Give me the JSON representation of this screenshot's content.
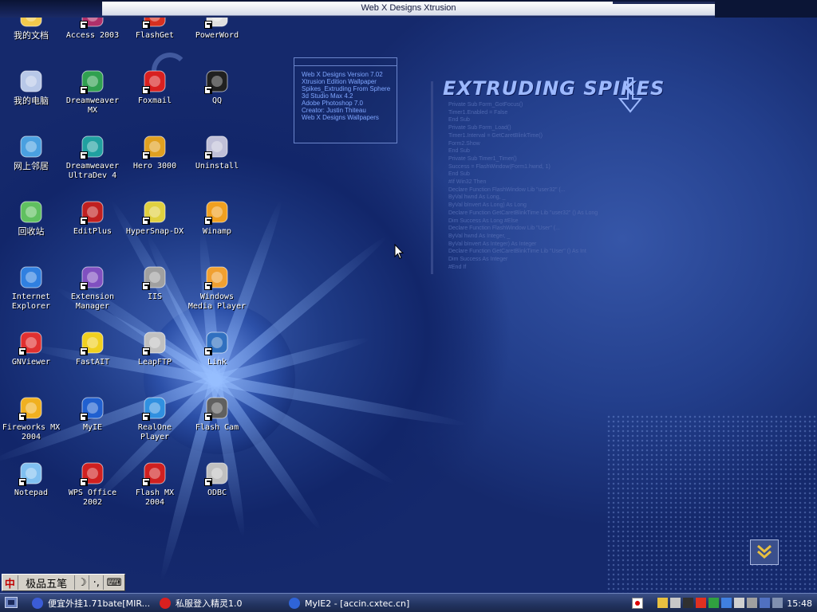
{
  "top_bar": {
    "title": "Web X Designs Xtrusion"
  },
  "info_box": {
    "lines": [
      "Web X Designs Version 7.02",
      "Xtrusion Edition Wallpaper",
      "Spikes_Extruding From Sphere",
      "3d Studio Max 4.2",
      "Adobe Photoshop 7.0",
      "Creator: Justin Thiteau",
      "Web X Designs Wallpapers"
    ]
  },
  "code_panel": {
    "title": "EXTRUDING SPIKES",
    "lines": [
      "Private Sub Form_GotFocus()",
      "   Timer1.Enabled = False",
      "   End Sub",
      "   Private Sub Form_Load()",
      "   Timer1.Interval = GetCaretBlinkTime()",
      "   Form2.Show",
      "   End Sub",
      "   Private Sub Timer1_Timer()",
      "   Success = FlashWindow(Form1.hwnd, 1)",
      " End Sub",
      "#If Win32 Then",
      "      Declare Function FlashWindow Lib \"user32\" (...",
      "      ByVal hwnd As Long, _",
      "      ByVal bInvert As Long) As Long",
      "      Declare Function GetCaretBlinkTime Lib \"user32\" () As Long",
      "      Dim Success As Long  #Else",
      "      Declare Function FlashWindow Lib \"User\" (...",
      "      ByVal hwnd As Integer, _",
      "      ByVal bInvert As Integer) As Integer",
      "      Declare Function GetCaretBlinkTime Lib \"User\" () As Int",
      "      Dim Success As Integer",
      "#End If"
    ]
  },
  "desktop_icons": [
    {
      "label": "我的文档",
      "icon": "folder-documents-icon"
    },
    {
      "label": "Access 2003",
      "icon": "access-icon"
    },
    {
      "label": "FlashGet",
      "icon": "flashget-icon"
    },
    {
      "label": "PowerWord",
      "icon": "powerword-icon"
    },
    {
      "label": "我的电脑",
      "icon": "computer-icon"
    },
    {
      "label": "Dreamweaver\nMX",
      "icon": "dreamweaver-icon"
    },
    {
      "label": "Foxmail",
      "icon": "foxmail-icon"
    },
    {
      "label": "QQ",
      "icon": "qq-penguin-icon"
    },
    {
      "label": "网上邻居",
      "icon": "network-icon"
    },
    {
      "label": "Dreamweaver\nUltraDev 4",
      "icon": "ultradev-icon"
    },
    {
      "label": "Hero 3000",
      "icon": "hero-player-icon"
    },
    {
      "label": "Uninstall",
      "icon": "uninstall-icon"
    },
    {
      "label": "回收站",
      "icon": "recycle-bin-icon"
    },
    {
      "label": "EditPlus",
      "icon": "editplus-icon"
    },
    {
      "label": "HyperSnap-DX",
      "icon": "hypersnap-icon"
    },
    {
      "label": "Winamp",
      "icon": "winamp-icon"
    },
    {
      "label": "Internet\nExplorer",
      "icon": "internet-explorer-icon"
    },
    {
      "label": "Extension\nManager",
      "icon": "extension-manager-icon"
    },
    {
      "label": "IIS",
      "icon": "iis-icon"
    },
    {
      "label": "Windows\nMedia Player",
      "icon": "media-player-icon"
    },
    {
      "label": "GNViewer",
      "icon": "gnviewer-icon"
    },
    {
      "label": "FastAIT",
      "icon": "fastait-icon"
    },
    {
      "label": "LeapFTP",
      "icon": "leapftp-icon"
    },
    {
      "label": "Link",
      "icon": "link-icon"
    },
    {
      "label": "Fireworks MX\n2004",
      "icon": "fireworks-icon"
    },
    {
      "label": "MyIE",
      "icon": "myie-icon"
    },
    {
      "label": "RealOne\nPlayer",
      "icon": "realone-icon"
    },
    {
      "label": "Flash Cam",
      "icon": "flash-cam-icon"
    },
    {
      "label": "Notepad",
      "icon": "notepad-icon"
    },
    {
      "label": "WPS Office\n2002",
      "icon": "wps-office-icon"
    },
    {
      "label": "Flash MX\n2004",
      "icon": "flash-mx-icon"
    },
    {
      "label": "ODBC",
      "icon": "odbc-icon"
    }
  ],
  "ime_bar": {
    "mode": "中",
    "name": "极品五笔",
    "moon": "☽",
    "punct": "·,",
    "keyboard": "⌨"
  },
  "taskbar": {
    "buttons": [
      {
        "label": "便宜外挂1.71bate[MIR...",
        "icon": "bug-icon",
        "color": "#3b5cd6"
      },
      {
        "label": "私服登入精灵1.0",
        "icon": "power-icon",
        "color": "#d92020"
      },
      {
        "label": "MyIE2 - [accin.cxtec.cn]",
        "icon": "myie2-icon",
        "color": "#2f64d8"
      }
    ],
    "clock": "15:48"
  },
  "colors": {
    "desktop": "#1f3b86",
    "info_text": "#7fa6ff",
    "code_text": "#4f68b0",
    "taskbar": "#22335f"
  }
}
